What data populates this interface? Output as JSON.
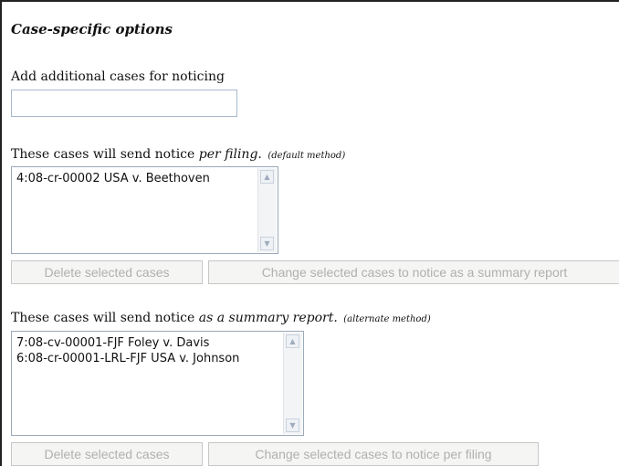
{
  "section_title": "Case-specific options",
  "add_cases": {
    "label": "Add additional cases for noticing",
    "value": ""
  },
  "per_filing": {
    "label_prefix": "These cases will send notice ",
    "label_emphasis": "per filing.",
    "label_note": "(default method)",
    "cases": [
      "4:08-cr-00002 USA v. Beethoven"
    ],
    "delete_button": "Delete selected cases",
    "change_button": "Change selected cases to notice as a summary report"
  },
  "summary_report": {
    "label_prefix": "These cases will send notice ",
    "label_emphasis": "as a summary report.",
    "label_note": "(alternate method)",
    "cases": [
      "7:08-cv-00001-FJF Foley v. Davis",
      "6:08-cr-00001-LRL-FJF USA v. Johnson"
    ],
    "delete_button": "Delete selected cases",
    "change_button": "Change selected cases to notice per filing"
  },
  "icons": {
    "scroll_up": "up-triangle-icon",
    "scroll_down": "down-triangle-icon"
  }
}
